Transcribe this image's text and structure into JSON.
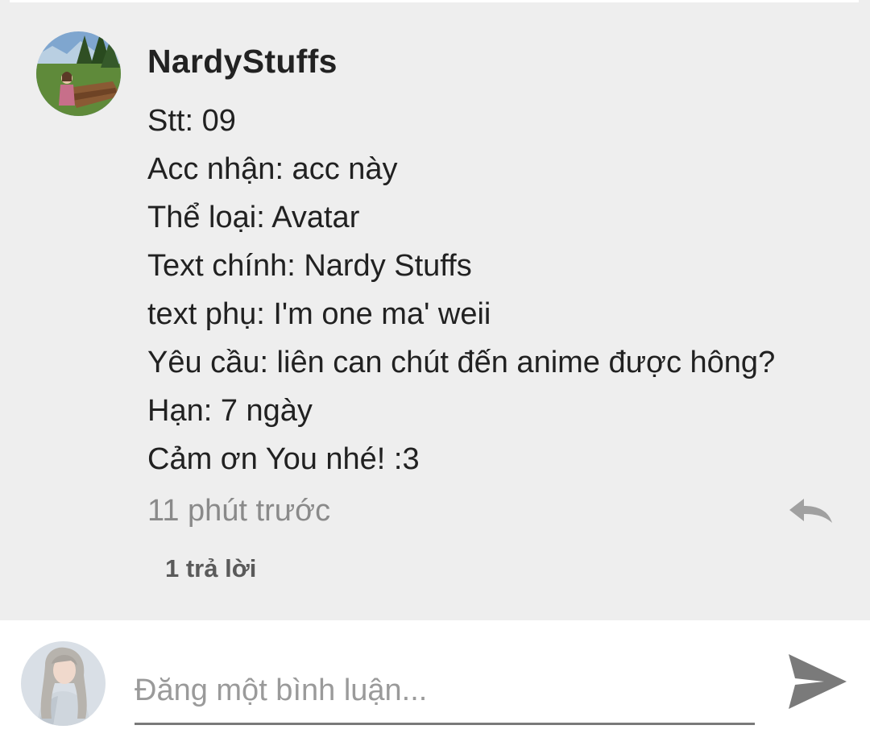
{
  "comment": {
    "username": "NardyStuffs",
    "avatar_icon": "landscape-photo-avatar",
    "lines": [
      "Stt: 09",
      "Acc nhận: acc này",
      "Thể loại: Avatar",
      "Text chính: Nardy Stuffs",
      "text phụ: I'm one ma' weii",
      "Yêu cầu: liên can chút đến anime được hông?",
      "Hạn: 7 ngày",
      "Cảm ơn You nhé! :3"
    ],
    "timestamp": "11 phút trước",
    "reply_icon": "reply-arrow-icon",
    "replies_label": "1 trả lời"
  },
  "compose": {
    "avatar_icon": "user-photo-avatar",
    "placeholder": "Đăng một bình luận...",
    "send_icon": "send-icon"
  },
  "colors": {
    "panel_bg": "#eeeeee",
    "compose_bg": "#ffffff",
    "muted_text": "#8a8a8a",
    "icon_gray": "#7a7a7a"
  }
}
